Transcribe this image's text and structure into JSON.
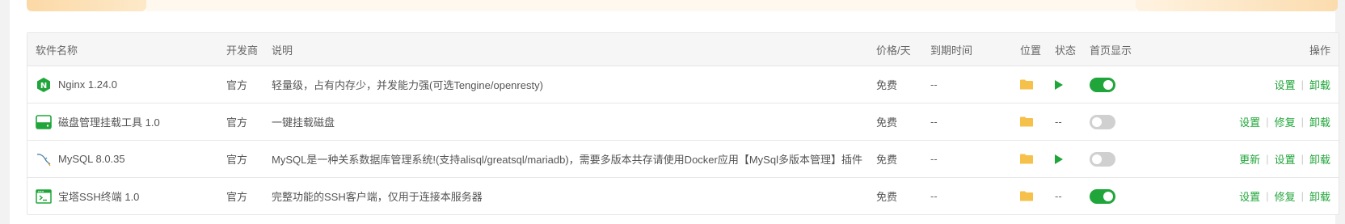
{
  "table": {
    "headers": {
      "name": "软件名称",
      "developer": "开发商",
      "description": "说明",
      "price": "价格/天",
      "expire": "到期时间",
      "location": "位置",
      "status": "状态",
      "homepage": "首页显示",
      "actions": "操作"
    },
    "rows": [
      {
        "name": "Nginx 1.24.0",
        "icon": "nginx-icon",
        "developer": "官方",
        "description": "轻量级，占有内存少，并发能力强(可选Tengine/openresty)",
        "price": "免费",
        "expire": "--",
        "status": "running",
        "status_text": "",
        "homepage_on": true,
        "actions": [
          "设置",
          "卸载"
        ]
      },
      {
        "name": "磁盘管理挂载工具 1.0",
        "icon": "disk-icon",
        "developer": "官方",
        "description": "一键挂载磁盘",
        "price": "免费",
        "expire": "--",
        "status": "none",
        "status_text": "--",
        "homepage_on": false,
        "actions": [
          "设置",
          "修复",
          "卸载"
        ]
      },
      {
        "name": "MySQL 8.0.35",
        "icon": "mysql-icon",
        "developer": "官方",
        "description": "MySQL是一种关系数据库管理系统!(支持alisql/greatsql/mariadb)，需要多版本共存请使用Docker应用【MySql多版本管理】插件",
        "price": "免费",
        "expire": "--",
        "status": "running",
        "status_text": "",
        "homepage_on": false,
        "actions": [
          "更新",
          "设置",
          "卸载"
        ]
      },
      {
        "name": "宝塔SSH终端 1.0",
        "icon": "terminal-icon",
        "developer": "官方",
        "description": "完整功能的SSH客户端，仅用于连接本服务器",
        "price": "免费",
        "expire": "--",
        "status": "none",
        "status_text": "--",
        "homepage_on": true,
        "actions": [
          "设置",
          "修复",
          "卸载"
        ]
      }
    ]
  },
  "colors": {
    "accent_green": "#20a53a",
    "folder_yellow": "#f5c14a",
    "toggle_off": "#d0d0d0"
  }
}
